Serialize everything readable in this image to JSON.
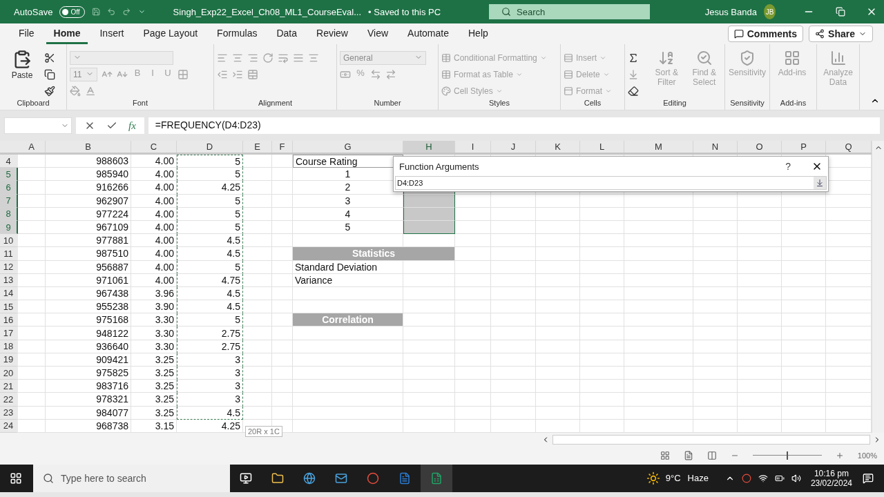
{
  "title_bar": {
    "autosave_label": "AutoSave",
    "autosave_toggle": {
      "label": "Off",
      "on": false
    },
    "file_title": "Singh_Exp22_Excel_Ch08_ML1_CourseEval...",
    "saved_status": "• Saved to this PC",
    "search_placeholder": "Search",
    "user_name": "Jesus Banda",
    "avatar_initials": "JB"
  },
  "menu_tabs": [
    {
      "label": "File",
      "selected": false
    },
    {
      "label": "Home",
      "selected": true
    },
    {
      "label": "Insert",
      "selected": false
    },
    {
      "label": "Page Layout",
      "selected": false
    },
    {
      "label": "Formulas",
      "selected": false
    },
    {
      "label": "Data",
      "selected": false
    },
    {
      "label": "Review",
      "selected": false
    },
    {
      "label": "View",
      "selected": false
    },
    {
      "label": "Automate",
      "selected": false
    },
    {
      "label": "Help",
      "selected": false
    }
  ],
  "comments_button": "Comments",
  "share_button": "Share",
  "ribbon": [
    {
      "label": "Clipboard",
      "items": [
        {
          "kind": "large",
          "label": "Paste",
          "disabled": false
        },
        {
          "kind": "icon",
          "disabled": false
        },
        {
          "kind": "icon",
          "disabled": false
        },
        {
          "kind": "icon",
          "disabled": false
        }
      ]
    },
    {
      "label": "Font",
      "items": [
        {
          "kind": "field",
          "disabled": true
        },
        {
          "kind": "field",
          "value": "11",
          "disabled": true
        },
        {
          "kind": "icon",
          "disabled": true
        },
        {
          "kind": "icon",
          "disabled": true
        },
        {
          "kind": "text",
          "label": "B",
          "disabled": true
        },
        {
          "kind": "text",
          "label": "I",
          "disabled": true
        },
        {
          "kind": "text",
          "label": "U",
          "disabled": true
        },
        {
          "kind": "icon",
          "disabled": true
        },
        {
          "kind": "icon",
          "disabled": true
        },
        {
          "kind": "icon",
          "disabled": true
        }
      ]
    },
    {
      "label": "Alignment",
      "items": [
        {
          "kind": "icon",
          "disabled": true
        },
        {
          "kind": "icon",
          "disabled": true
        },
        {
          "kind": "icon",
          "disabled": true
        },
        {
          "kind": "icon",
          "disabled": true
        },
        {
          "kind": "icon",
          "disabled": true
        },
        {
          "kind": "icon",
          "disabled": true
        },
        {
          "kind": "icon",
          "disabled": true
        },
        {
          "kind": "icon",
          "disabled": true
        },
        {
          "kind": "icon",
          "disabled": true
        },
        {
          "kind": "icon",
          "disabled": true
        }
      ]
    },
    {
      "label": "Number",
      "items": [
        {
          "kind": "field",
          "value": "General",
          "disabled": true
        },
        {
          "kind": "icon",
          "disabled": true
        },
        {
          "kind": "text",
          "label": "%",
          "disabled": true
        },
        {
          "kind": "icon",
          "disabled": true
        },
        {
          "kind": "icon",
          "disabled": true
        }
      ]
    },
    {
      "label": "Styles",
      "items": [
        {
          "kind": "small",
          "label": "Conditional Formatting",
          "disabled": true
        },
        {
          "kind": "small",
          "label": "Format as Table",
          "disabled": true
        },
        {
          "kind": "small",
          "label": "Cell Styles",
          "disabled": true
        }
      ]
    },
    {
      "label": "Cells",
      "items": [
        {
          "kind": "small",
          "label": "Insert",
          "disabled": true
        },
        {
          "kind": "small",
          "label": "Delete",
          "disabled": true
        },
        {
          "kind": "small",
          "label": "Format",
          "disabled": true
        }
      ]
    },
    {
      "label": "Editing",
      "items": [
        {
          "kind": "icon",
          "disabled": false
        },
        {
          "kind": "icon",
          "disabled": true
        },
        {
          "kind": "icon",
          "disabled": false
        },
        {
          "kind": "large",
          "label": "Sort & Filter",
          "disabled": true
        },
        {
          "kind": "large",
          "label": "Find & Select",
          "disabled": true
        }
      ]
    },
    {
      "label": "Sensitivity",
      "items": [
        {
          "kind": "large",
          "label": "Sensitivity",
          "disabled": true
        }
      ]
    },
    {
      "label": "Add-ins",
      "items": [
        {
          "kind": "large",
          "label": "Add-ins",
          "disabled": true
        }
      ]
    },
    {
      "items": [
        {
          "kind": "large",
          "label": "Analyze Data",
          "disabled": true
        }
      ]
    }
  ],
  "formula_bar": {
    "function_symbol": "fx",
    "formula": "=FREQUENCY(D4:D23)"
  },
  "columns": [
    {
      "label": "A",
      "selected": false
    },
    {
      "label": "B",
      "selected": false
    },
    {
      "label": "C",
      "selected": false
    },
    {
      "label": "D",
      "selected": false
    },
    {
      "label": "E",
      "selected": false
    },
    {
      "label": "F",
      "selected": false
    },
    {
      "label": "G",
      "selected": false
    },
    {
      "label": "H",
      "selected": true
    },
    {
      "label": "I",
      "selected": false
    },
    {
      "label": "J",
      "selected": false
    },
    {
      "label": "K",
      "selected": false
    },
    {
      "label": "L",
      "selected": false
    },
    {
      "label": "M",
      "selected": false
    },
    {
      "label": "N",
      "selected": false
    },
    {
      "label": "O",
      "selected": false
    },
    {
      "label": "P",
      "selected": false
    },
    {
      "label": "Q",
      "selected": false
    }
  ],
  "rows": [
    {
      "number": "4",
      "column_b": "988603",
      "column_c": "4.00",
      "column_d": "5",
      "copied": true,
      "h_selected": false,
      "summary": {
        "kind": "heading",
        "text": "Course Rating"
      }
    },
    {
      "number": "5",
      "column_b": "985940",
      "column_c": "4.00",
      "column_d": "5",
      "copied": true,
      "h_selected": true,
      "summary": {
        "kind": "value",
        "text": "1"
      }
    },
    {
      "number": "6",
      "column_b": "916266",
      "column_c": "4.00",
      "column_d": "4.25",
      "copied": true,
      "h_selected": true,
      "summary": {
        "kind": "value",
        "text": "2"
      }
    },
    {
      "number": "7",
      "column_b": "962907",
      "column_c": "4.00",
      "column_d": "5",
      "copied": true,
      "h_selected": true,
      "summary": {
        "kind": "value",
        "text": "3"
      }
    },
    {
      "number": "8",
      "column_b": "977224",
      "column_c": "4.00",
      "column_d": "5",
      "copied": true,
      "h_selected": true,
      "summary": {
        "kind": "value",
        "text": "4"
      }
    },
    {
      "number": "9",
      "column_b": "967109",
      "column_c": "4.00",
      "column_d": "5",
      "copied": true,
      "h_selected": true,
      "summary": {
        "kind": "value",
        "text": "5"
      }
    },
    {
      "number": "10",
      "column_b": "977881",
      "column_c": "4.00",
      "column_d": "4.5",
      "copied": true,
      "h_selected": false
    },
    {
      "number": "11",
      "column_b": "987510",
      "column_c": "4.00",
      "column_d": "4.5",
      "copied": true,
      "h_selected": false,
      "summary": {
        "kind": "section",
        "wide": true,
        "text": "Statistics"
      }
    },
    {
      "number": "12",
      "column_b": "956887",
      "column_c": "4.00",
      "column_d": "5",
      "copied": true,
      "h_selected": false,
      "summary": {
        "kind": "label",
        "text": "Standard Deviation"
      }
    },
    {
      "number": "13",
      "column_b": "971061",
      "column_c": "4.00",
      "column_d": "4.75",
      "copied": true,
      "h_selected": false,
      "summary": {
        "kind": "label",
        "text": "Variance"
      }
    },
    {
      "number": "14",
      "column_b": "967438",
      "column_c": "3.96",
      "column_d": "4.5",
      "copied": true,
      "h_selected": false
    },
    {
      "number": "15",
      "column_b": "955238",
      "column_c": "3.90",
      "column_d": "4.5",
      "copied": true,
      "h_selected": false
    },
    {
      "number": "16",
      "column_b": "975168",
      "column_c": "3.30",
      "column_d": "5",
      "copied": true,
      "h_selected": false,
      "summary": {
        "kind": "section",
        "wide": false,
        "text": "Correlation"
      }
    },
    {
      "number": "17",
      "column_b": "948122",
      "column_c": "3.30",
      "column_d": "2.75",
      "copied": true,
      "h_selected": false
    },
    {
      "number": "18",
      "column_b": "936640",
      "column_c": "3.30",
      "column_d": "2.75",
      "copied": true,
      "h_selected": false
    },
    {
      "number": "19",
      "column_b": "909421",
      "column_c": "3.25",
      "column_d": "3",
      "copied": true,
      "h_selected": false
    },
    {
      "number": "20",
      "column_b": "975825",
      "column_c": "3.25",
      "column_d": "3",
      "copied": true,
      "h_selected": false
    },
    {
      "number": "21",
      "column_b": "983716",
      "column_c": "3.25",
      "column_d": "3",
      "copied": true,
      "h_selected": false
    },
    {
      "number": "22",
      "column_b": "978321",
      "column_c": "3.25",
      "column_d": "3",
      "copied": true,
      "h_selected": false
    },
    {
      "number": "23",
      "column_b": "984077",
      "column_c": "3.25",
      "column_d": "4.5",
      "copied": true,
      "h_selected": false
    },
    {
      "number": "24",
      "column_b": "968738",
      "column_c": "3.15",
      "column_d": "4.25",
      "copied": false,
      "h_selected": false
    }
  ],
  "range_tip": "20R x 1C",
  "dialog": {
    "title": "Function Arguments",
    "help": "?",
    "value": "D4:D23"
  },
  "status_bar": {
    "zoom": {
      "level": 0.5,
      "reading": "100%"
    }
  },
  "taskbar": {
    "search_placeholder": "Type here to search",
    "temperature": "9°C",
    "weather": "Haze",
    "time": "10:16 pm",
    "date": "23/02/2024"
  }
}
